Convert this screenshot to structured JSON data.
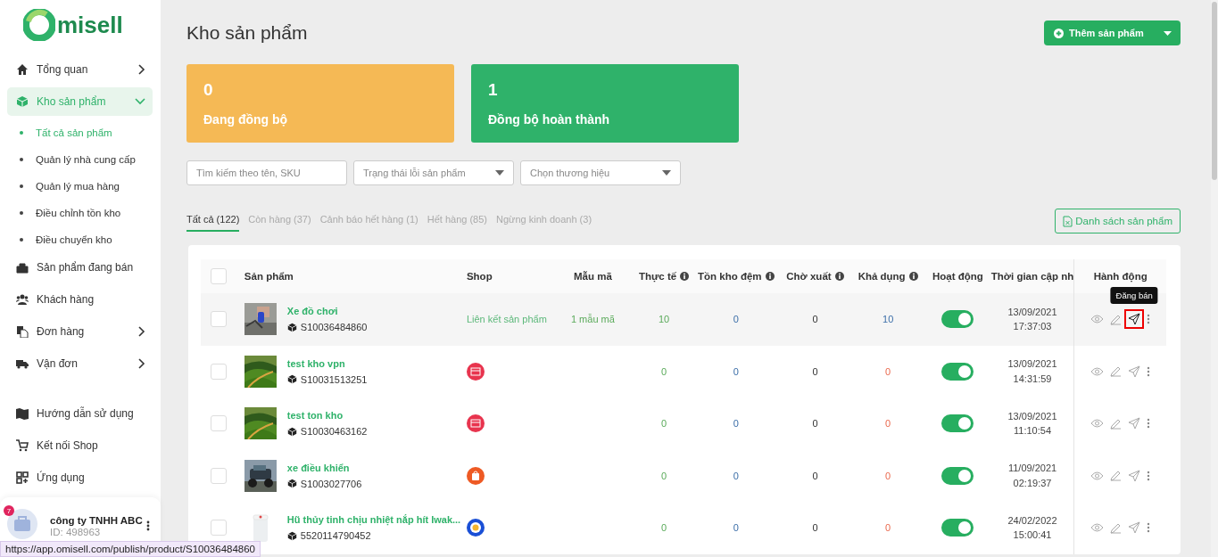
{
  "logo": "misell",
  "nav": [
    {
      "label": "Tổng quan",
      "expanded": false,
      "selected": false
    },
    {
      "label": "Kho sản phẩm",
      "expanded": true,
      "selected": true,
      "children": [
        {
          "label": "Tất cả sản phẩm",
          "selected": true
        },
        {
          "label": "Quản lý nhà cung cấp",
          "selected": false
        },
        {
          "label": "Quản lý mua hàng",
          "selected": false
        },
        {
          "label": "Điều chỉnh tồn kho",
          "selected": false
        },
        {
          "label": "Điều chuyển kho",
          "selected": false
        }
      ]
    },
    {
      "label": "Sản phẩm đang bán",
      "selected": false
    },
    {
      "label": "Khách hàng",
      "selected": false
    },
    {
      "label": "Đơn hàng",
      "expanded": false,
      "selected": false
    },
    {
      "label": "Vận đơn",
      "expanded": false,
      "selected": false
    }
  ],
  "nav_bottom": [
    {
      "label": "Hướng dẫn sử dụng"
    },
    {
      "label": "Kết nối Shop"
    },
    {
      "label": "Ứng dụng"
    }
  ],
  "account": {
    "badge": "7",
    "name": "công ty TNHH ABC",
    "id": "ID: 498963"
  },
  "page_title": "Kho sản phẩm",
  "add_button": "Thêm sản phẩm",
  "stats": [
    {
      "value": "0",
      "label": "Đang đồng bộ",
      "color": "#f5b955"
    },
    {
      "value": "1",
      "label": "Đồng bộ hoàn thành",
      "color": "#2fb26a"
    }
  ],
  "filters": {
    "search": {
      "placeholder": "Tìm kiếm theo tên, SKU"
    },
    "dropdowns": [
      {
        "placeholder": "Trạng thái lỗi sản phẩm"
      },
      {
        "placeholder": "Chọn thương hiệu"
      }
    ]
  },
  "tabs": [
    {
      "label": "Tất cả (122)",
      "selected": true
    },
    {
      "label": "Còn hàng (37)",
      "selected": false
    },
    {
      "label": "Cảnh báo hết hàng (1)",
      "selected": false
    },
    {
      "label": "Hết hàng (85)",
      "selected": false
    },
    {
      "label": "Ngừng kinh doanh (3)",
      "selected": false
    }
  ],
  "list_button": "Danh sách sản phẩm",
  "table": {
    "select_all_checked": false,
    "columns": [
      {
        "label": "Sản phẩm",
        "info": false
      },
      {
        "label": "Shop",
        "info": false
      },
      {
        "label": "Mẫu mã",
        "info": false
      },
      {
        "label": "Thực tế",
        "info": true
      },
      {
        "label": "Tồn kho đệm",
        "info": true
      },
      {
        "label": "Chờ xuất",
        "info": true
      },
      {
        "label": "Khả dụng",
        "info": true
      },
      {
        "label": "Hoạt động",
        "info": false
      },
      {
        "label": "Thời gian cập nh",
        "info": false
      },
      {
        "label": "Hành động",
        "info": false
      }
    ],
    "rows": [
      {
        "name": "Xe đồ chơi",
        "sku": "S10036484860",
        "shop": {
          "kind": "link",
          "text": "Liên kết sản phẩm"
        },
        "variants": "1 mẫu mã",
        "actual": "10",
        "buffer": "0",
        "pending": "0",
        "available": "10",
        "out_of_stock": false,
        "checked": false,
        "active": true,
        "date": "13/09/2021",
        "time": "17:37:03",
        "highlighted": true,
        "tooltip": "Đăng bán"
      },
      {
        "name": "test kho vpn",
        "sku": "S10031513251",
        "shop": {
          "kind": "store",
          "color": "#e8344e"
        },
        "actual": "0",
        "buffer": "0",
        "pending": "0",
        "available": "0",
        "out_of_stock": true,
        "checked": false,
        "active": true,
        "date": "13/09/2021",
        "time": "14:31:59",
        "highlighted": false
      },
      {
        "name": "test ton kho",
        "sku": "S10030463162",
        "shop": {
          "kind": "store",
          "color": "#e8344e"
        },
        "actual": "0",
        "buffer": "0",
        "pending": "0",
        "available": "0",
        "out_of_stock": true,
        "checked": false,
        "active": true,
        "date": "13/09/2021",
        "time": "11:10:54",
        "highlighted": false
      },
      {
        "name": "xe điều khiển",
        "sku": "S1003027706",
        "shop": {
          "kind": "bag",
          "color": "#ee5a24"
        },
        "actual": "0",
        "buffer": "0",
        "pending": "0",
        "available": "0",
        "out_of_stock": true,
        "checked": false,
        "active": true,
        "date": "11/09/2021",
        "time": "02:19:37",
        "highlighted": false
      },
      {
        "name": "Hũ thủy tinh chịu nhiệt nắp hít Iwak...",
        "sku": "5520114790452",
        "shop": {
          "kind": "ring",
          "color": "#1a4fd6"
        },
        "actual": "0",
        "buffer": "0",
        "pending": "0",
        "available": "0",
        "out_of_stock": true,
        "checked": false,
        "active": true,
        "date": "24/02/2022",
        "time": "15:00:41",
        "highlighted": false
      }
    ]
  },
  "status_url": "https://app.omisell.com/publish/product/S10036484860"
}
